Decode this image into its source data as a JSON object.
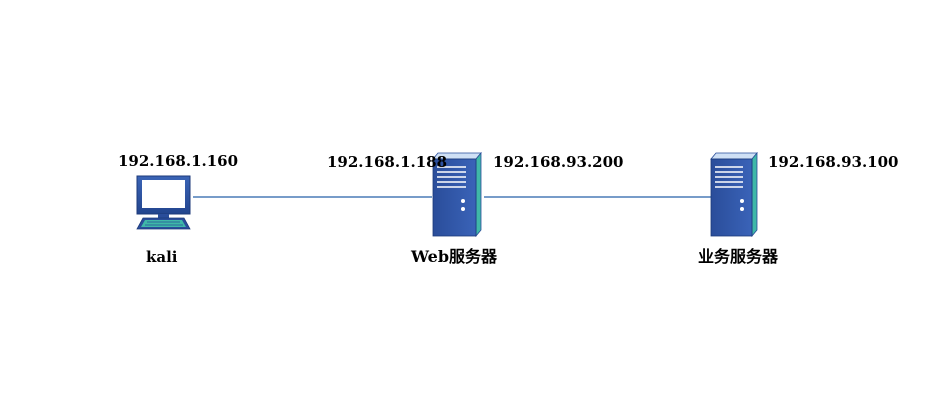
{
  "nodes": {
    "kali": {
      "ip": "192.168.1.160",
      "name": "kali",
      "icon": "desktop-computer-icon"
    },
    "web_server": {
      "ip_left": "192.168.1.188",
      "ip_right": "192.168.93.200",
      "name": "Web服务器",
      "icon": "server-tower-icon"
    },
    "business_server": {
      "ip": "192.168.93.100",
      "name": "业务服务器",
      "icon": "server-tower-icon"
    }
  },
  "colors": {
    "link_line": "#4a7bb7",
    "device_blue": "#2d4f9c",
    "device_light": "#cfe0f5",
    "device_teal": "#3fb8a8"
  }
}
